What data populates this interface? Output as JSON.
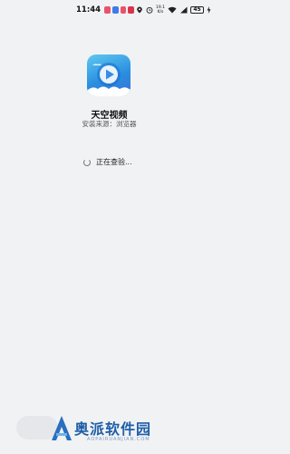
{
  "status_bar": {
    "time": "11:44",
    "network_speed_top": "19.1",
    "network_speed_bottom": "K/s",
    "battery": "45"
  },
  "app": {
    "name": "天空视频",
    "source": "安装来源：浏览器"
  },
  "status": {
    "checking_text": "正在查验..."
  },
  "watermark": {
    "text": "奥派软件园",
    "url": "AOPAIRUANJIAN.COM"
  },
  "colors": {
    "background": "#f1f2f4",
    "icon_primary": "#2a8fe0",
    "watermark": "#1f5fa8"
  }
}
